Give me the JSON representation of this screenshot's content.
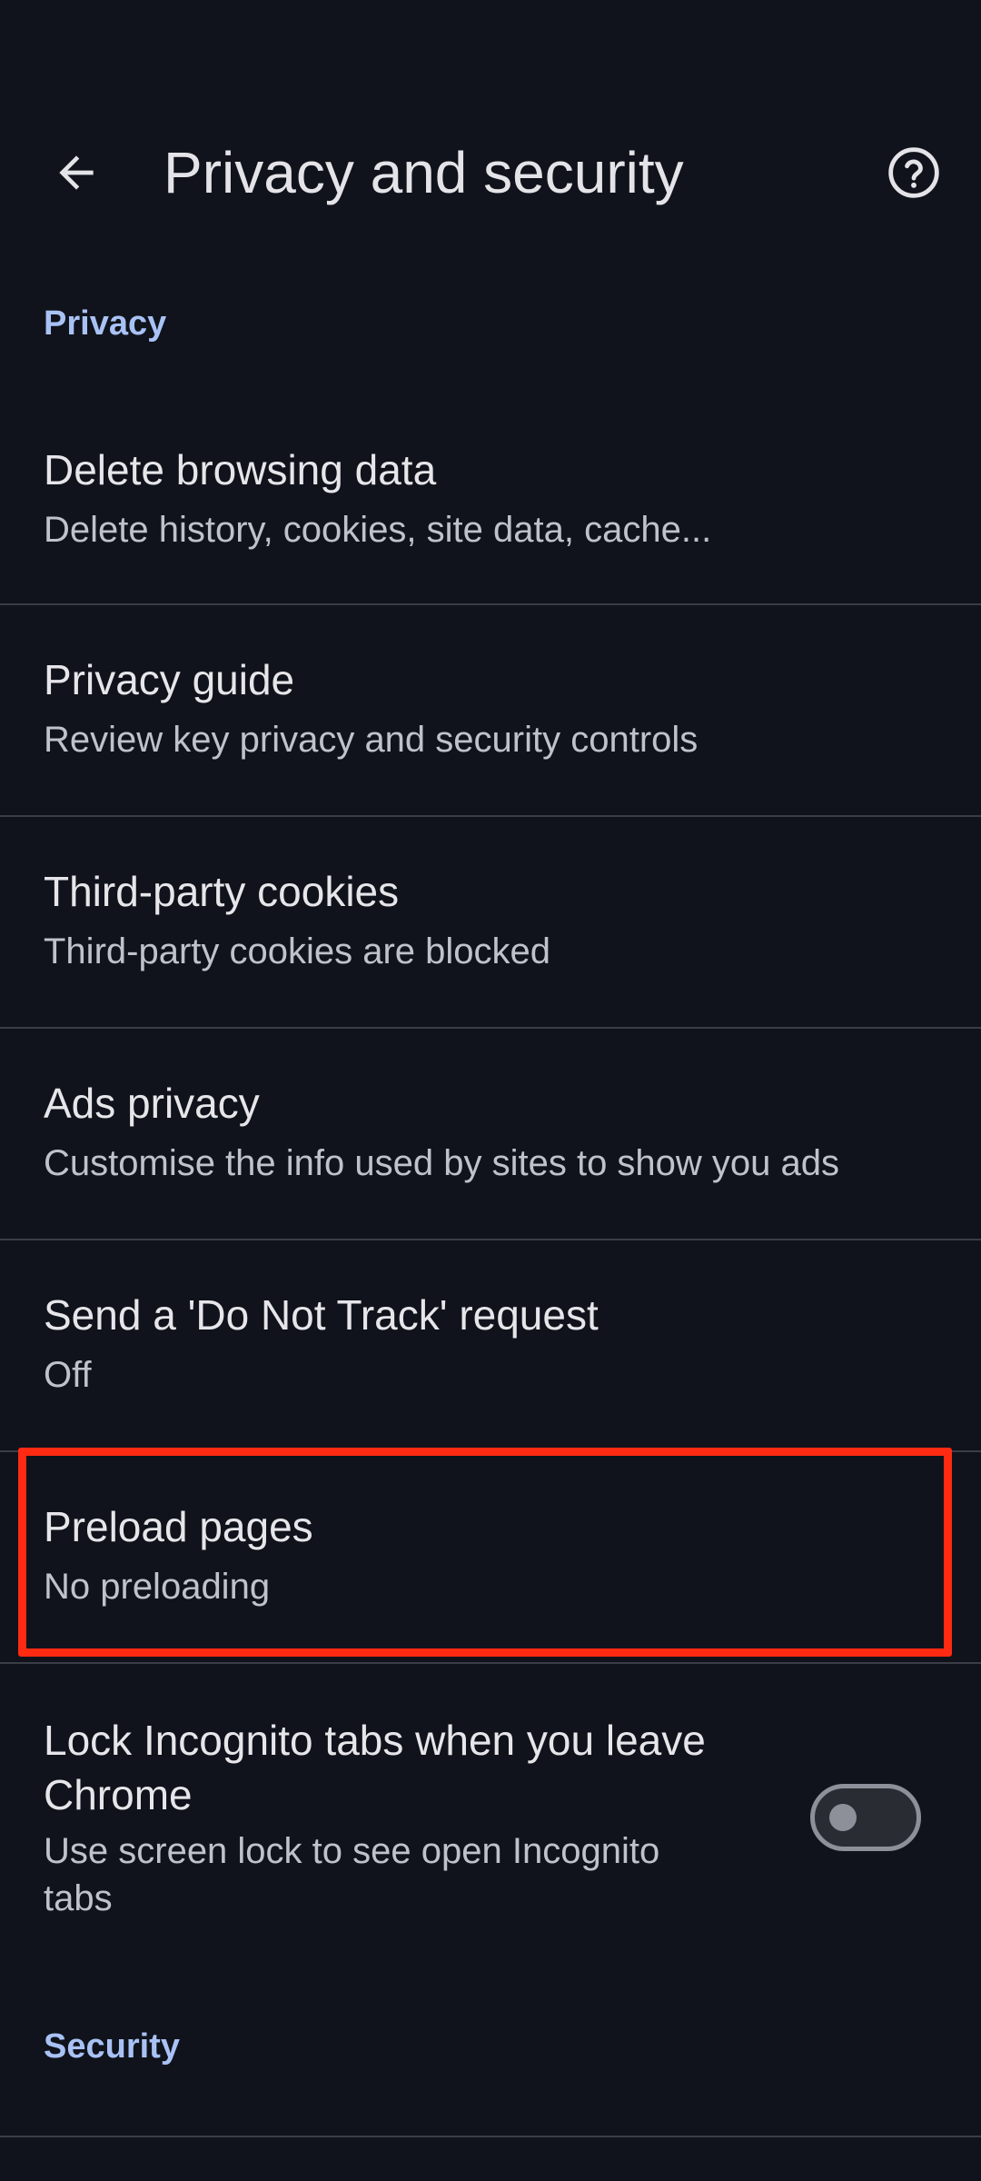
{
  "header": {
    "title": "Privacy and security",
    "back_icon": "arrow-left-icon",
    "help_icon": "help-circle-icon"
  },
  "sections": {
    "privacy_label": "Privacy",
    "security_label": "Security"
  },
  "settings": [
    {
      "title": "Delete browsing data",
      "summary": "Delete history, cookies, site data, cache..."
    },
    {
      "title": "Privacy guide",
      "summary": "Review key privacy and security controls"
    },
    {
      "title": "Third-party cookies",
      "summary": "Third-party cookies are blocked"
    },
    {
      "title": "Ads privacy",
      "summary": "Customise the info used by sites to show you ads"
    },
    {
      "title": "Send a 'Do Not Track' request",
      "summary": "Off"
    },
    {
      "title": "Preload pages",
      "summary": "No preloading"
    }
  ],
  "incognito_lock": {
    "title_line1": "Lock Incognito tabs when you leave",
    "title_line2": "Chrome",
    "summary_line1": "Use screen lock to see open Incognito",
    "summary_line2": "tabs",
    "enabled": false
  },
  "colors": {
    "background": "#10131b",
    "section_accent": "#a9c2f5",
    "highlight": "#ff2a12"
  }
}
